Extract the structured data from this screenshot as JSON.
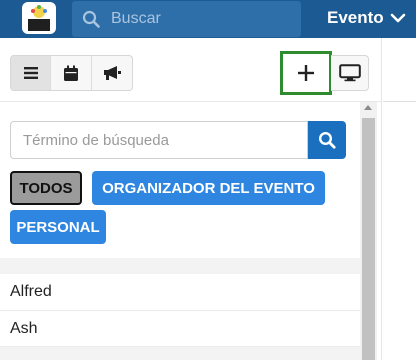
{
  "header": {
    "search_placeholder": "Buscar",
    "event_label": "Evento",
    "colors": {
      "bar": "#1b5a93",
      "search_bg": "#2f6fa9"
    }
  },
  "toolbar": {
    "view_icons": [
      "list-icon",
      "calendar-icon",
      "megaphone-icon"
    ],
    "add_icon": "plus-icon",
    "display_icon": "monitor-icon",
    "highlight_color": "#2e8b2e"
  },
  "search": {
    "placeholder": "Término de búsqueda",
    "value": ""
  },
  "filters": [
    {
      "label": "TODOS",
      "selected": true
    },
    {
      "label": "ORGANIZADOR DEL EVENTO",
      "selected": false
    },
    {
      "label": "PERSONAL",
      "selected": false
    }
  ],
  "people": [
    "Alfred",
    "Ash"
  ],
  "accent": "#2f86e0"
}
